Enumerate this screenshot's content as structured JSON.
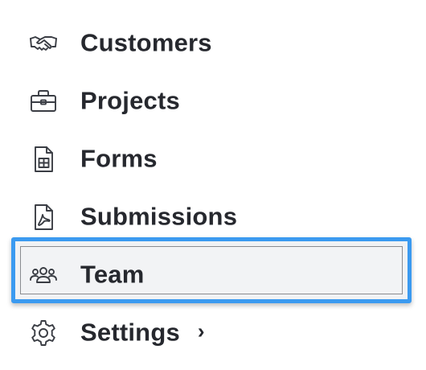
{
  "nav": {
    "items": [
      {
        "label": "Customers",
        "icon": "handshake-icon"
      },
      {
        "label": "Projects",
        "icon": "toolbox-icon"
      },
      {
        "label": "Forms",
        "icon": "spreadsheet-doc-icon"
      },
      {
        "label": "Submissions",
        "icon": "pdf-doc-icon"
      },
      {
        "label": "Team",
        "icon": "team-icon",
        "active": true
      },
      {
        "label": "Settings",
        "icon": "gear-icon",
        "has_submenu": true,
        "chevron": "›"
      }
    ]
  },
  "colors": {
    "highlight_border": "#3b9af0",
    "active_bg": "#f1f2f4",
    "text": "#26282e"
  }
}
